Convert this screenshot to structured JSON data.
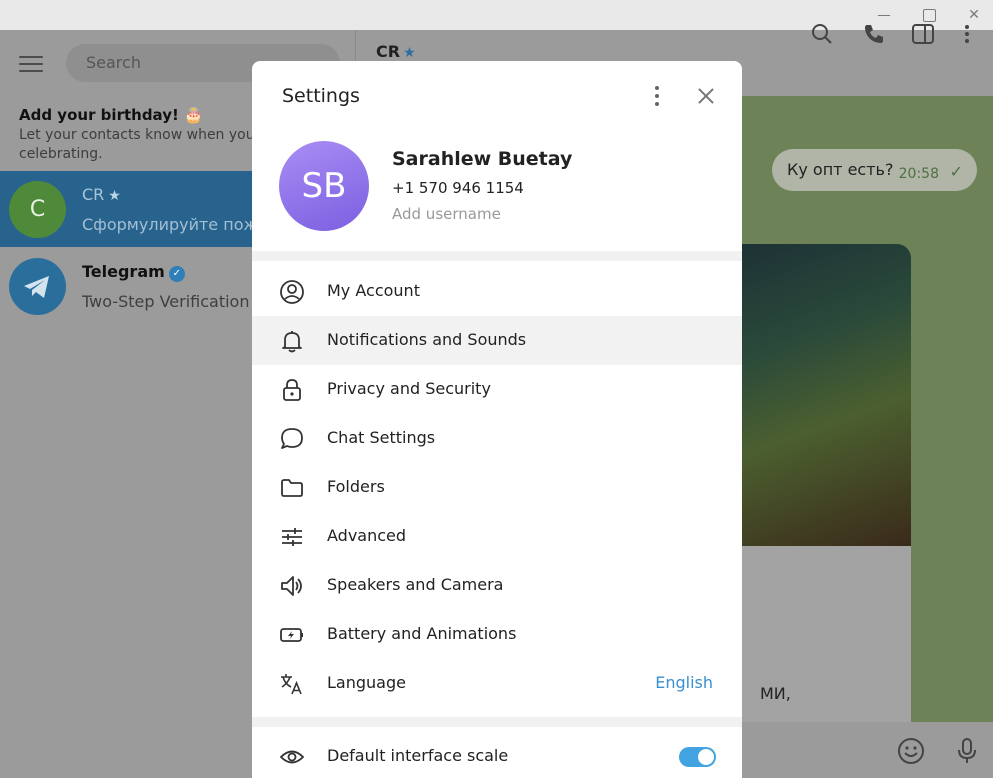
{
  "sidebar": {
    "search_placeholder": "Search",
    "birthday_title": "Add your birthday! 🎂",
    "birthday_text_1": "Let your contacts know when you're",
    "birthday_text_2": "celebrating.",
    "chats": [
      {
        "initial": "C",
        "name": "CR",
        "preview": "Сформулируйте пожа"
      },
      {
        "name": "Telegram",
        "preview": "Two-Step Verification c"
      }
    ]
  },
  "chat": {
    "title": "CR",
    "outgoing_text": "Ку опт есть?",
    "outgoing_time": "20:58",
    "partial_text": "МИ,"
  },
  "settings": {
    "title": "Settings",
    "profile": {
      "initials": "SB",
      "name": "Sarahlew Buetay",
      "phone": "+1 570 946 1154",
      "username_placeholder": "Add username"
    },
    "items": [
      {
        "label": "My Account",
        "icon": "account-icon"
      },
      {
        "label": "Notifications and Sounds",
        "icon": "bell-icon"
      },
      {
        "label": "Privacy and Security",
        "icon": "lock-icon"
      },
      {
        "label": "Chat Settings",
        "icon": "chat-bubble-icon"
      },
      {
        "label": "Folders",
        "icon": "folder-icon"
      },
      {
        "label": "Advanced",
        "icon": "sliders-icon"
      },
      {
        "label": "Speakers and Camera",
        "icon": "speaker-icon"
      },
      {
        "label": "Battery and Animations",
        "icon": "battery-icon"
      },
      {
        "label": "Language",
        "icon": "translate-icon",
        "value": "English"
      }
    ],
    "scale": {
      "label": "Default interface scale",
      "icon": "eye-icon",
      "enabled": true
    }
  },
  "colors": {
    "accent": "#42a3e0",
    "link": "#3a8fd0",
    "avatar": "#8b6fe8"
  }
}
